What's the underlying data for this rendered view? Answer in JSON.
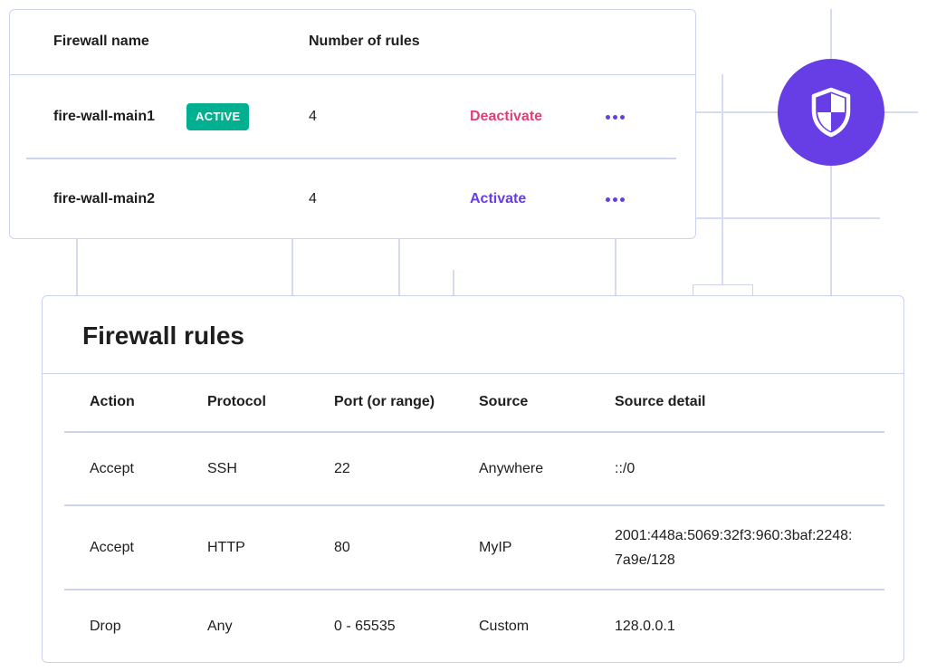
{
  "firewalls": {
    "headers": {
      "name": "Firewall name",
      "rules": "Number of rules"
    },
    "rows": [
      {
        "name": "fire-wall-main1",
        "badge": "ACTIVE",
        "rules": "4",
        "action": "Deactivate",
        "action_color": "#e23f77",
        "more_icon": "more-horizontal-icon"
      },
      {
        "name": "fire-wall-main2",
        "badge": "",
        "rules": "4",
        "action": "Activate",
        "action_color": "#673de6",
        "more_icon": "more-horizontal-icon"
      }
    ]
  },
  "shield": {
    "icon": "shield-icon",
    "color": "#673de6"
  },
  "rules": {
    "title": "Firewall rules",
    "headers": [
      "Action",
      "Protocol",
      "Port (or range)",
      "Source",
      "Source detail"
    ],
    "rows": [
      [
        "Accept",
        "SSH",
        "22",
        "Anywhere",
        "::/0"
      ],
      [
        "Accept",
        "HTTP",
        "80",
        "MyIP",
        "2001:448a:5069:32f3:960:3baf:2248:7a9e/128"
      ],
      [
        "Drop",
        "Any",
        "0 - 65535",
        "Custom",
        "128.0.0.1"
      ]
    ]
  },
  "colors": {
    "accent": "#673de6",
    "danger": "#e23f77",
    "success": "#00b090",
    "border": "#cdd3ef"
  }
}
